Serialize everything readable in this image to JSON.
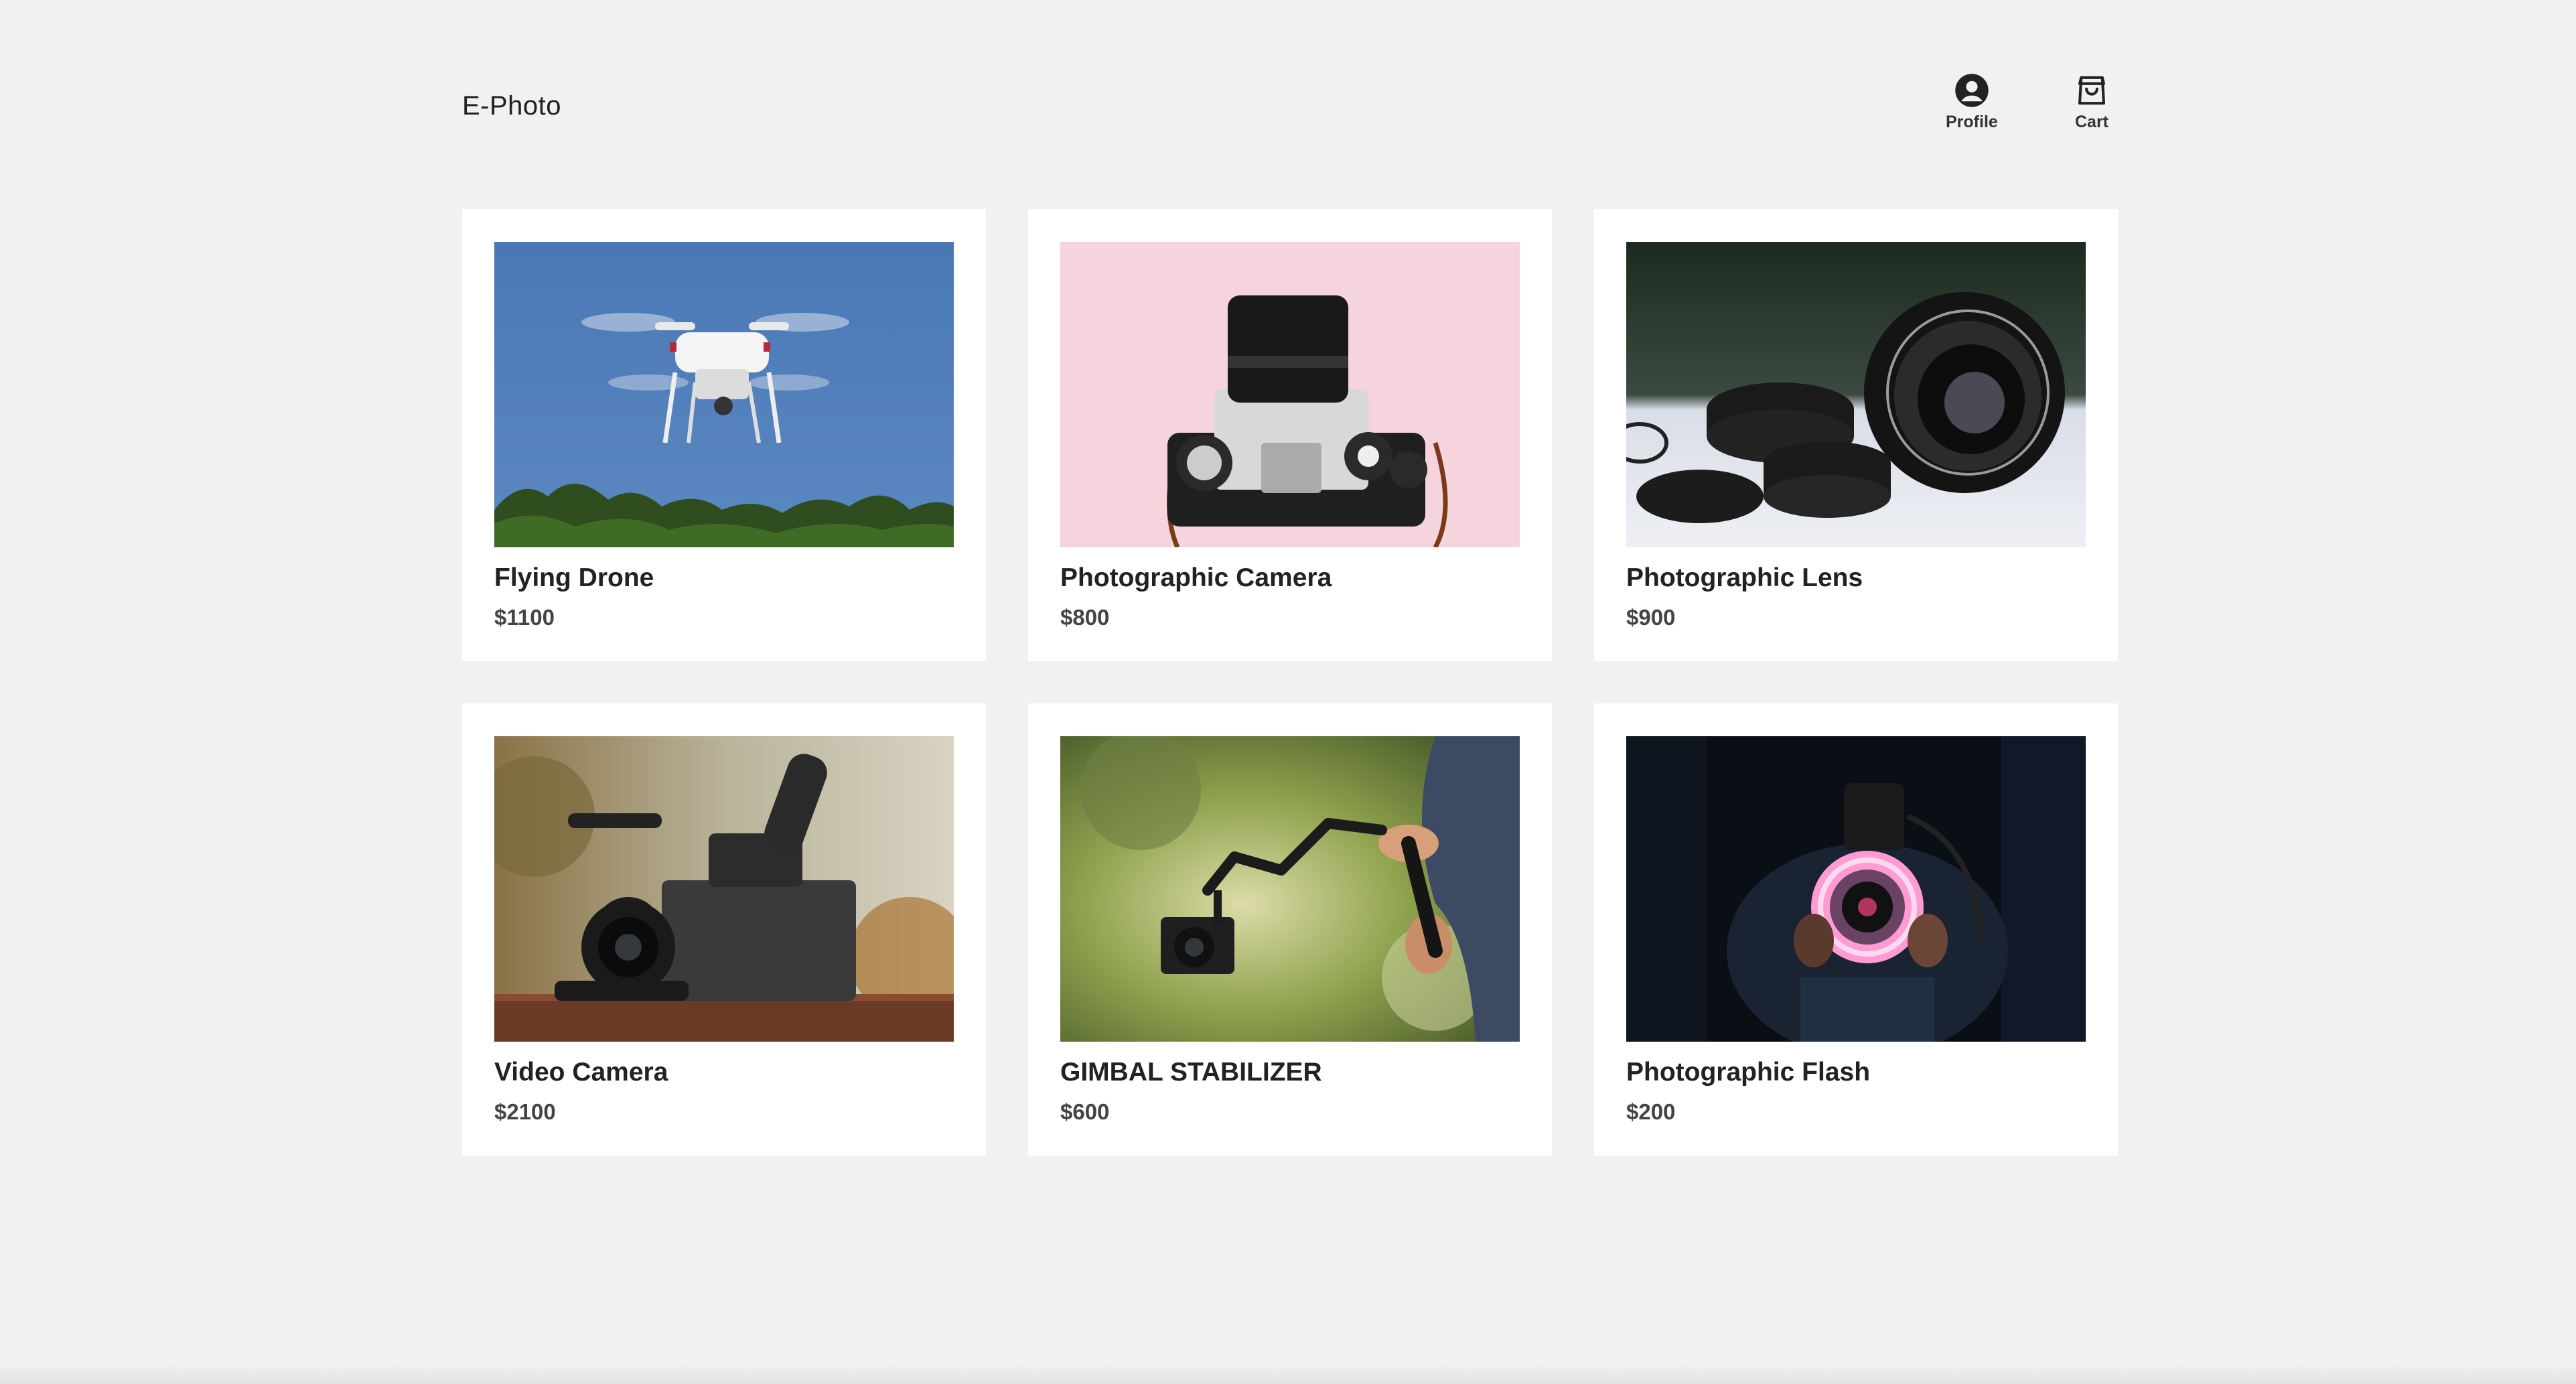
{
  "header": {
    "brand": "E-Photo",
    "profile_label": "Profile",
    "cart_label": "Cart"
  },
  "icons": {
    "profile": "user-circle-icon",
    "cart": "shopping-bag-icon"
  },
  "colors": {
    "background": "#f1f1f1",
    "card": "#ffffff",
    "text": "#222222",
    "price": "#444444"
  },
  "products": [
    {
      "name": "Flying Drone",
      "price": "$1100",
      "image": "drone-photo"
    },
    {
      "name": "Photographic Camera",
      "price": "$800",
      "image": "film-camera-photo"
    },
    {
      "name": "Photographic Lens",
      "price": "$900",
      "image": "camera-lens-photo"
    },
    {
      "name": "Video Camera",
      "price": "$2100",
      "image": "video-camera-photo"
    },
    {
      "name": "GIMBAL STABILIZER",
      "price": "$600",
      "image": "gimbal-photo"
    },
    {
      "name": "Photographic Flash",
      "price": "$200",
      "image": "ring-flash-photo"
    }
  ]
}
